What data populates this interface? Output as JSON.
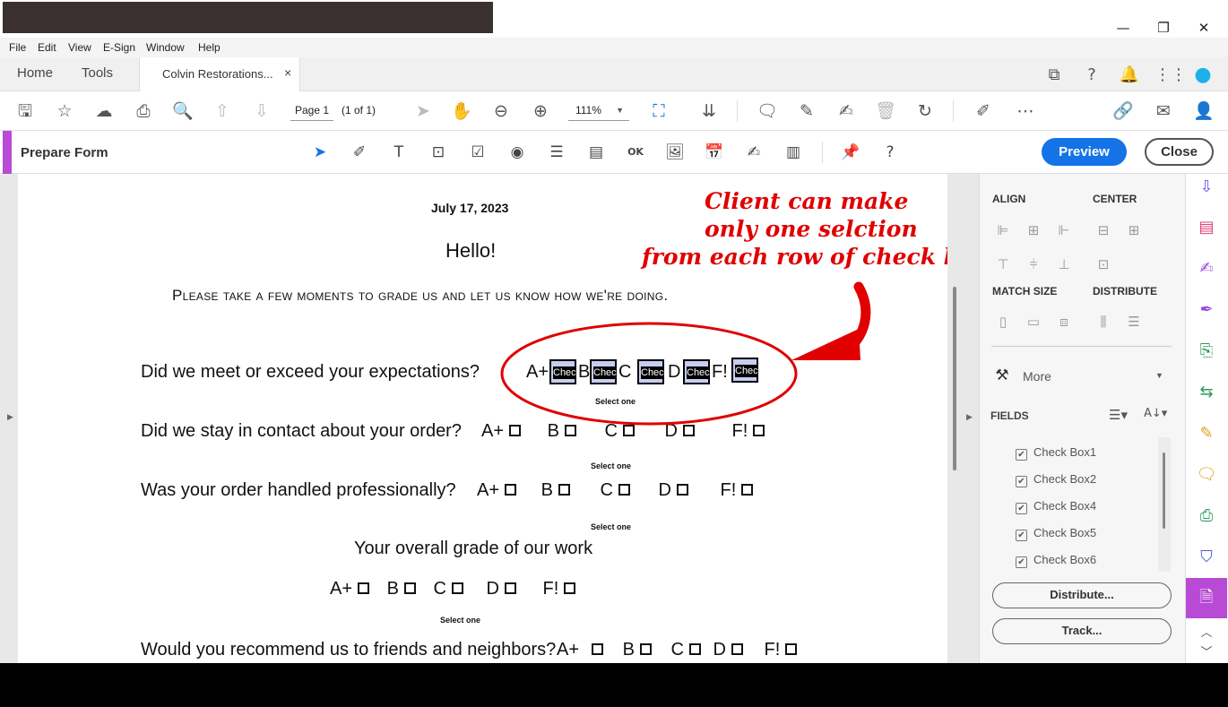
{
  "window": {
    "minimize": "—",
    "restore": "❐",
    "close": "✕"
  },
  "menu": [
    "File",
    "Edit",
    "View",
    "E-Sign",
    "Window",
    "Help"
  ],
  "tabs": {
    "home": "Home",
    "tools": "Tools",
    "document": "Colvin Restorations...",
    "close_tab": "×"
  },
  "toolbar": {
    "page_field": "Page 1",
    "page_of": "(1 of 1)",
    "zoom": "111%"
  },
  "prepare_form": {
    "title": "Prepare Form",
    "preview": "Preview",
    "close": "Close"
  },
  "document": {
    "date": "July 17, 2023",
    "greeting": "Hello!",
    "intro": "Please take a few moments to grade us and let us  know how we're doing.",
    "select_one": "Select one",
    "q1": "Did we meet or exceed your expectations?",
    "q2": "Did we stay in contact about your order?",
    "q3": "Was your order handled professionally?",
    "q4": "Your overall grade of our work",
    "q5": "Would you recommend us to friends and neighbors?",
    "grades": [
      "A+",
      "B",
      "C",
      "D",
      "F!"
    ],
    "field_label": "Chec",
    "annotation": [
      "Client can make",
      "only one selction",
      "from each row of check boxes"
    ]
  },
  "right_panel": {
    "align": "ALIGN",
    "center": "CENTER",
    "match_size": "MATCH SIZE",
    "distribute": "DISTRIBUTE",
    "more": "More",
    "fields": "FIELDS",
    "field_list": [
      "Check Box1",
      "Check Box2",
      "Check Box4",
      "Check Box5",
      "Check Box6"
    ],
    "distribute_btn": "Distribute...",
    "track_btn": "Track..."
  },
  "colors": {
    "accent_purple": "#b84ad6",
    "preview_blue": "#1473e6",
    "annotation_red": "#e00000"
  }
}
